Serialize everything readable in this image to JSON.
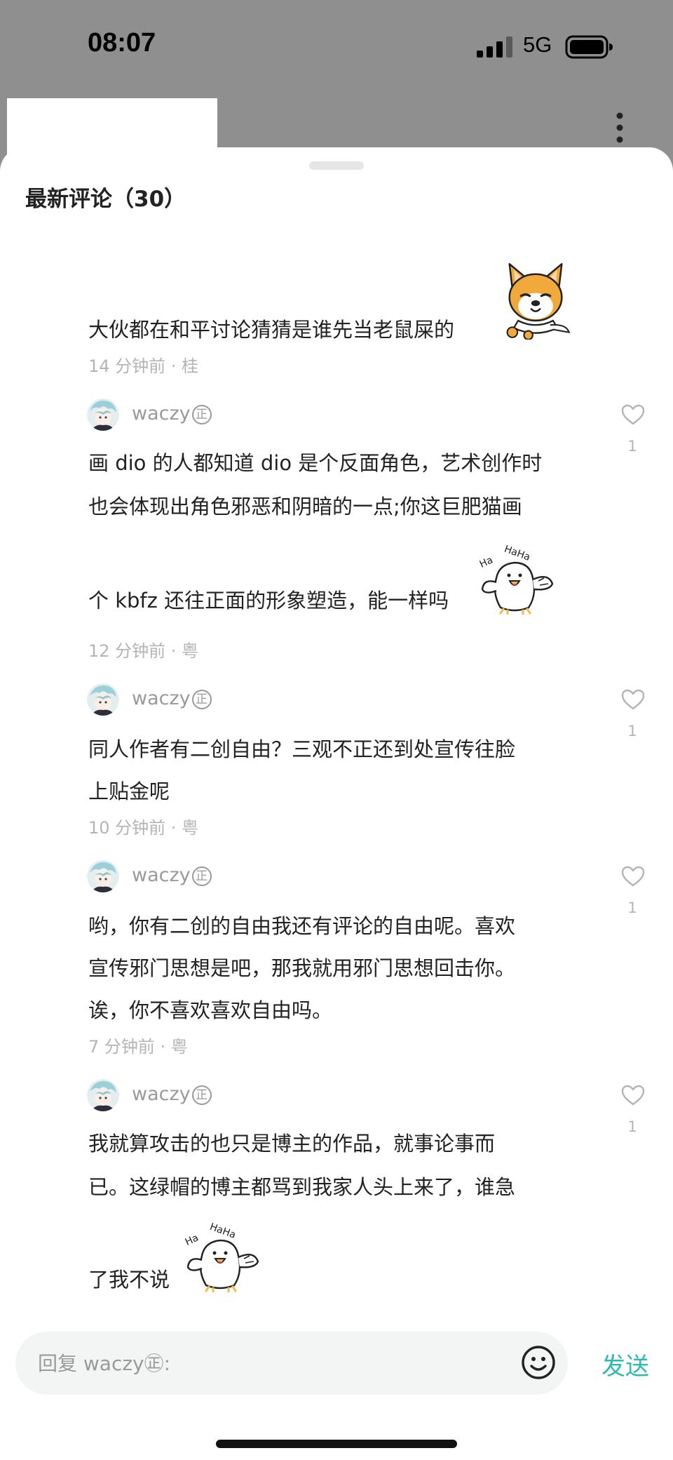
{
  "status_bar": {
    "time": "08:07",
    "network": "5G",
    "icons": [
      "signal-icon",
      "battery-icon"
    ]
  },
  "header": {
    "title": "最新评论（30）",
    "icons": [
      "more-icon"
    ]
  },
  "comments": [
    {
      "lines": [
        "大伙都在和平讨论猜猜是谁先当老鼠屎的"
      ],
      "meta": "14 分钟前 · 桂",
      "sticker": "doge-sticker"
    },
    {
      "username": "waczy",
      "badge": "正",
      "lines": [
        "画 dio 的人都知道 dio 是个反面角色，艺术创作时",
        "也会体现出角色邪恶和阴暗的一点;你这巨肥猫画",
        "个 kbfz 还往正面的形象塑造，能一样吗"
      ],
      "meta": "12 分钟前 · 粤",
      "likes": "1",
      "sticker": "laughing-bird-sticker"
    },
    {
      "username": "waczy",
      "badge": "正",
      "lines": [
        "同人作者有二创自由？三观不正还到处宣传往脸",
        "上贴金呢"
      ],
      "meta": "10 分钟前 · 粤",
      "likes": "1"
    },
    {
      "username": "waczy",
      "badge": "正",
      "lines": [
        "哟，你有二创的自由我还有评论的自由呢。喜欢",
        "宣传邪门思想是吧，那我就用邪门思想回击你。",
        "诶，你不喜欢喜欢自由吗。"
      ],
      "meta": "7 分钟前 · 粤",
      "likes": "1"
    },
    {
      "username": "waczy",
      "badge": "正",
      "lines": [
        "我就算攻击的也只是博主的作品，就事论事而",
        "已。这绿帽的博主都骂到我家人头上来了，谁急",
        "了我不说"
      ],
      "likes": "1",
      "sticker": "laughing-bird-sticker"
    }
  ],
  "composer": {
    "placeholder": "回复 waczy㊣:",
    "send_label": "发送",
    "icons": [
      "emoji-icon"
    ]
  },
  "colors": {
    "accent": "#2fb9b5",
    "backdrop": "#8f8f8f",
    "meta_text": "#b4b4b4"
  }
}
